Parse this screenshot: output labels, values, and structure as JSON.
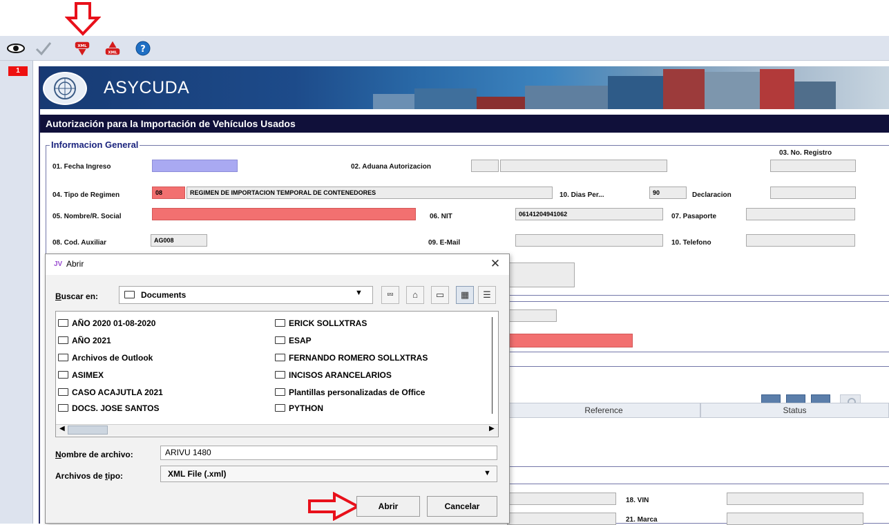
{
  "toolbar": {
    "buttons": [
      "eye-icon",
      "check-icon",
      "xml-import-icon",
      "xml-export-icon",
      "help-icon"
    ]
  },
  "tab": {
    "number": "1"
  },
  "header": {
    "brand": "ASYCUDA"
  },
  "form": {
    "title": "Autorización para la Importación de Vehículos Usados",
    "section_title": "Informacion General",
    "fields": {
      "f01_label": "01. Fecha Ingreso",
      "f02_label": "02. Aduana Autorizacion",
      "f03_label": "03. No. Registro",
      "f04_label": "04. Tipo de Regimen",
      "f04_code": "08",
      "f04_desc": "REGIMEN DE IMPORTACION TEMPORAL DE CONTENEDORES",
      "f10d_label": "10. Dias Per...",
      "f10d_value": "90",
      "declaracion_label": "Declaracion",
      "f05_label": "05. Nombre/R. Social",
      "f06_label": "06. NIT",
      "f06_value": "06141204941062",
      "f07_label": "07. Pasaporte",
      "f08_label": "08. Cod. Auxiliar",
      "f08_value": "AG008",
      "f09_label": "09. E-Mail",
      "f10t_label": "10. Telefono",
      "f18_label": "18. VIN",
      "f21_label": "21. Marca"
    },
    "table": {
      "columns": [
        "Reference",
        "Status"
      ]
    }
  },
  "dialog": {
    "title": "Abrir",
    "buscar_label": "Buscar en:",
    "buscar_value": "Documents",
    "files_col1": [
      "AÑO 2020 01-08-2020",
      "AÑO 2021",
      "Archivos de Outlook",
      "ASIMEX",
      "CASO ACAJUTLA 2021",
      "DOCS. JOSE SANTOS"
    ],
    "files_col2": [
      "ERICK SOLLXTRAS",
      "ESAP",
      "FERNANDO ROMERO SOLLXTRAS",
      "INCISOS ARANCELARIOS",
      "Plantillas personalizadas de Office",
      "PYTHON"
    ],
    "nombre_label": "Nombre de archivo:",
    "nombre_value": "ARIVU 1480",
    "tipo_label": "Archivos de tipo:",
    "tipo_value": "XML File (.xml)",
    "open_button": "Abrir",
    "cancel_button": "Cancelar"
  },
  "colors": {
    "annotation_red": "#e8101a",
    "title_bar": "#10103a",
    "required_red": "#f27070",
    "date_blue": "#a9a9f2"
  }
}
